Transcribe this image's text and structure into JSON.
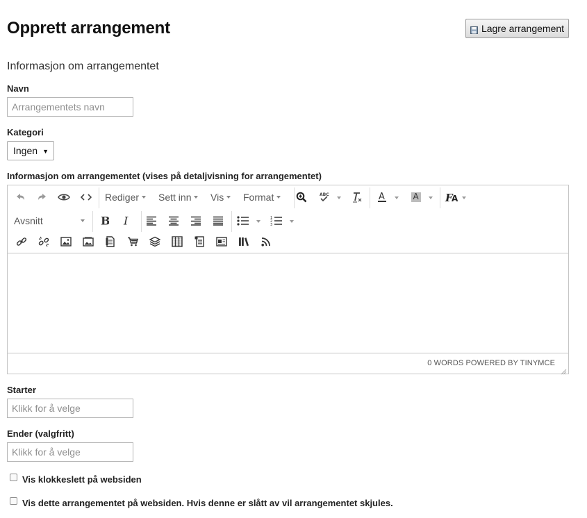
{
  "header": {
    "title": "Opprett arrangement",
    "save_label": "Lagre arrangement"
  },
  "form": {
    "section_title": "Informasjon om arrangementet",
    "name": {
      "label": "Navn",
      "placeholder": "Arrangementets navn",
      "value": ""
    },
    "category": {
      "label": "Kategori",
      "selected": "Ingen"
    },
    "description": {
      "label": "Informasjon om arrangementet (vises på detaljvisning for arrangementet)"
    },
    "start": {
      "label": "Starter",
      "placeholder": "Klikk for å velge"
    },
    "end": {
      "label": "Ender (valgfritt)",
      "placeholder": "Klikk for å velge"
    },
    "checkboxes": [
      {
        "label": "Vis klokkeslett på websiden",
        "checked": false
      },
      {
        "label": "Vis dette arrangementet på websiden. Hvis denne er slått av vil arrangementet skjules.",
        "checked": false
      }
    ]
  },
  "editor": {
    "menus": [
      "Rediger",
      "Sett inn",
      "Vis",
      "Format"
    ],
    "block_format": "Avsnitt",
    "status": "0 WORDS POWERED BY TINYMCE",
    "icons_row1": [
      "undo-icon",
      "redo-icon",
      "preview-icon",
      "code-icon",
      "zoom-icon",
      "spellcheck-icon",
      "clear-format-icon",
      "text-color-icon",
      "background-color-icon",
      "font-size-icon"
    ],
    "icons_row2": [
      "bold-icon",
      "italic-icon",
      "align-left-icon",
      "align-center-icon",
      "align-right-icon",
      "justify-icon",
      "bullet-list-icon",
      "numbered-list-icon"
    ],
    "icons_row3": [
      "link-icon",
      "unlink-icon",
      "image-icon",
      "gallery-icon",
      "document-icon",
      "shop-icon",
      "layers-icon",
      "table-grid-icon",
      "page-icon",
      "news-icon",
      "library-icon",
      "rss-icon"
    ]
  }
}
